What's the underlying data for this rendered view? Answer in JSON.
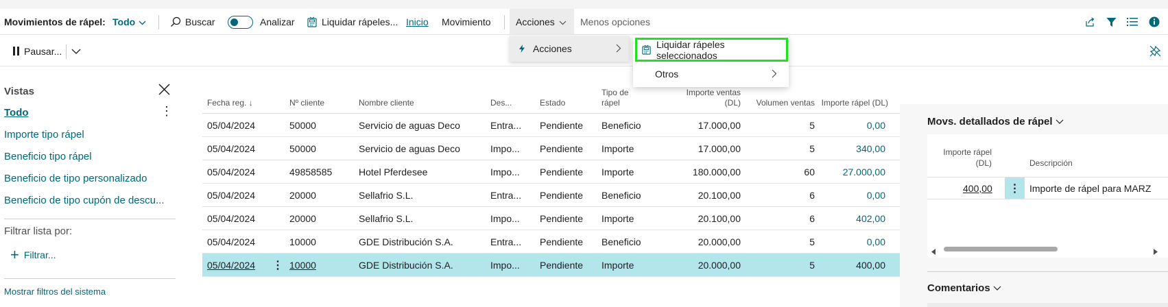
{
  "actionbar": {
    "title": "Movimientos de rápel:",
    "view_selector": "Todo",
    "search_label": "Buscar",
    "analyze_label": "Analizar",
    "settle_label": "Liquidar rápeles...",
    "tab_home": "Inicio",
    "tab_movement": "Movimiento",
    "actions_label": "Acciones",
    "fewer_options": "Menos opciones",
    "accent_color": "#00687a"
  },
  "toolbar2": {
    "pause_label": "Pausar..."
  },
  "views": {
    "title": "Vistas",
    "items": [
      {
        "label": "Todo"
      },
      {
        "label": "Importe tipo rápel"
      },
      {
        "label": "Beneficio tipo rápel"
      },
      {
        "label": "Beneficio de tipo personalizado"
      },
      {
        "label": "Beneficio de tipo cupón de descu..."
      }
    ],
    "filter_label": "Filtrar lista por:",
    "filter_button": "Filtrar...",
    "system_filters": "Mostrar filtros del sistema"
  },
  "table": {
    "headers": {
      "date": "Fecha reg. ↓",
      "customer_no": "Nº cliente",
      "customer_name": "Nombre cliente",
      "description": "Des...",
      "status": "Estado",
      "rebate_type_line1": "Tipo de",
      "rebate_type_line2": "rápel",
      "sales_amount_line1": "Importe ventas",
      "sales_amount_line2": "(DL)",
      "sales_volume": "Volumen ventas",
      "rebate_amount": "Importe rápel (DL)"
    },
    "rows": [
      {
        "date": "05/04/2024",
        "customer_no": "50000",
        "customer_name": "Servicio de aguas Deco",
        "description": "Entra...",
        "status": "Pendiente",
        "rebate_type": "Beneficio",
        "sales_amount": "17.000,00",
        "sales_volume": "5",
        "rebate_amount": "0,00"
      },
      {
        "date": "05/04/2024",
        "customer_no": "50000",
        "customer_name": "Servicio de aguas Deco",
        "description": "Impo...",
        "status": "Pendiente",
        "rebate_type": "Importe",
        "sales_amount": "17.000,00",
        "sales_volume": "5",
        "rebate_amount": "340,00"
      },
      {
        "date": "05/04/2024",
        "customer_no": "49858585",
        "customer_name": "Hotel Pferdesee",
        "description": "Impo...",
        "status": "Pendiente",
        "rebate_type": "Importe",
        "sales_amount": "180.000,00",
        "sales_volume": "60",
        "rebate_amount": "27.000,00"
      },
      {
        "date": "05/04/2024",
        "customer_no": "20000",
        "customer_name": "Sellafrio S.L.",
        "description": "Entra...",
        "status": "Pendiente",
        "rebate_type": "Beneficio",
        "sales_amount": "20.100,00",
        "sales_volume": "6",
        "rebate_amount": "0,00"
      },
      {
        "date": "05/04/2024",
        "customer_no": "20000",
        "customer_name": "Sellafrio S.L.",
        "description": "Impo...",
        "status": "Pendiente",
        "rebate_type": "Importe",
        "sales_amount": "20.100,00",
        "sales_volume": "6",
        "rebate_amount": "402,00"
      },
      {
        "date": "05/04/2024",
        "customer_no": "10000",
        "customer_name": "GDE Distribución S.A.",
        "description": "Entra...",
        "status": "Pendiente",
        "rebate_type": "Beneficio",
        "sales_amount": "20.000,00",
        "sales_volume": "5",
        "rebate_amount": "0,00"
      },
      {
        "date": "05/04/2024",
        "customer_no": "10000",
        "customer_name": "GDE Distribución S.A.",
        "description": "Impo...",
        "status": "Pendiente",
        "rebate_type": "Importe",
        "sales_amount": "20.000,00",
        "sales_volume": "5",
        "rebate_amount": "400,00"
      }
    ]
  },
  "menus": {
    "level1_label": "Acciones",
    "level2_selected": "Liquidar rápeles seleccionados",
    "level2_other": "Otros",
    "highlight_color": "#22e022"
  },
  "factbox": {
    "title": "Movs. detallados de rápel",
    "header_amount_line1": "Importe rápel",
    "header_amount_line2": "(DL)",
    "header_description": "Descripción",
    "amount": "400,00",
    "description": "Importe de rápel para MARZ",
    "comments_title": "Comentarios"
  }
}
